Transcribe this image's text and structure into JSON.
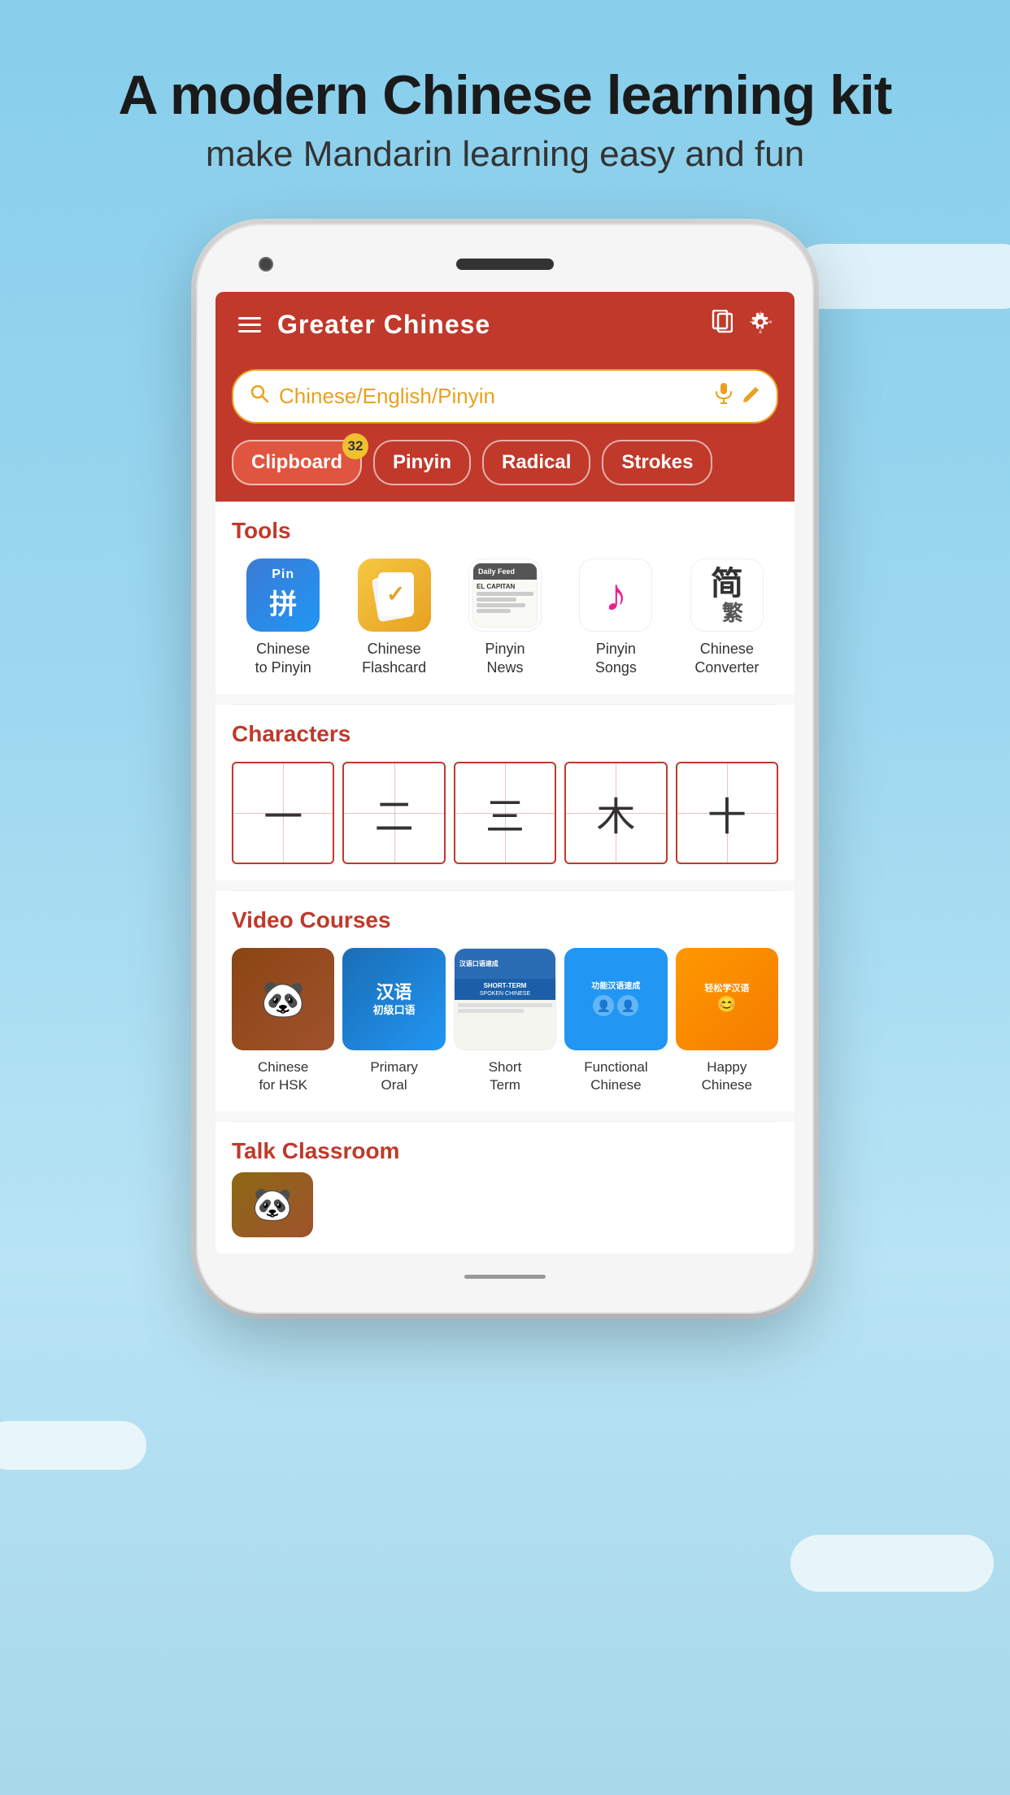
{
  "background": {
    "color": "#87CEEB"
  },
  "header": {
    "title": "A modern Chinese learning kit",
    "subtitle": "make Mandarin learning easy and fun"
  },
  "navbar": {
    "app_name": "Greater Chinese",
    "hamburger_label": "Menu",
    "bookmark_icon": "bookmark",
    "settings_icon": "settings"
  },
  "search": {
    "placeholder": "Chinese/English/Pinyin",
    "mic_icon": "microphone",
    "pen_icon": "pencil",
    "search_icon": "search"
  },
  "quick_buttons": [
    {
      "label": "Clipboard",
      "badge": "32",
      "active": true
    },
    {
      "label": "Pinyin",
      "badge": null,
      "active": false
    },
    {
      "label": "Radical",
      "badge": null,
      "active": false
    },
    {
      "label": "Strokes",
      "badge": null,
      "active": false
    }
  ],
  "tools_section": {
    "title": "Tools",
    "items": [
      {
        "id": "chinese-to-pinyin",
        "label_line1": "Chinese",
        "label_line2": "to Pinyin",
        "icon_type": "pinyin",
        "icon_text_top": "Pin",
        "icon_text_bottom": "拼"
      },
      {
        "id": "chinese-flashcard",
        "label_line1": "Chinese",
        "label_line2": "Flashcard",
        "icon_type": "flashcard"
      },
      {
        "id": "pinyin-news",
        "label_line1": "Pinyin",
        "label_line2": "News",
        "icon_type": "news",
        "news_title": "Daily Feed",
        "news_subtitle": "EL CAPITAN"
      },
      {
        "id": "pinyin-songs",
        "label_line1": "Pinyin",
        "label_line2": "Songs",
        "icon_type": "music"
      },
      {
        "id": "chinese-converter",
        "label_line1": "Chinese",
        "label_line2": "Converter",
        "icon_type": "converter",
        "char_simplified": "简",
        "char_traditional": "繁"
      }
    ]
  },
  "characters_section": {
    "title": "Characters",
    "chars": [
      "一",
      "二",
      "三",
      "木",
      "十"
    ]
  },
  "video_courses_section": {
    "title": "Video Courses",
    "items": [
      {
        "id": "chinese-hsk",
        "label_line1": "Chinese",
        "label_line2": "for HSK",
        "icon_type": "hsk",
        "emoji": "🐼"
      },
      {
        "id": "primary-oral",
        "label_line1": "Primary",
        "label_line2": "Oral",
        "icon_type": "oral",
        "text": "汉语初级口语"
      },
      {
        "id": "short-term",
        "label_line1": "Short",
        "label_line2": "Term",
        "icon_type": "short",
        "text": "汉语口语速成"
      },
      {
        "id": "functional-chinese",
        "label_line1": "Functional",
        "label_line2": "Chinese",
        "icon_type": "functional"
      },
      {
        "id": "happy-chinese",
        "label_line1": "Happy",
        "label_line2": "Chinese",
        "icon_type": "happy"
      }
    ]
  },
  "talk_section": {
    "title": "Talk Classroom"
  }
}
